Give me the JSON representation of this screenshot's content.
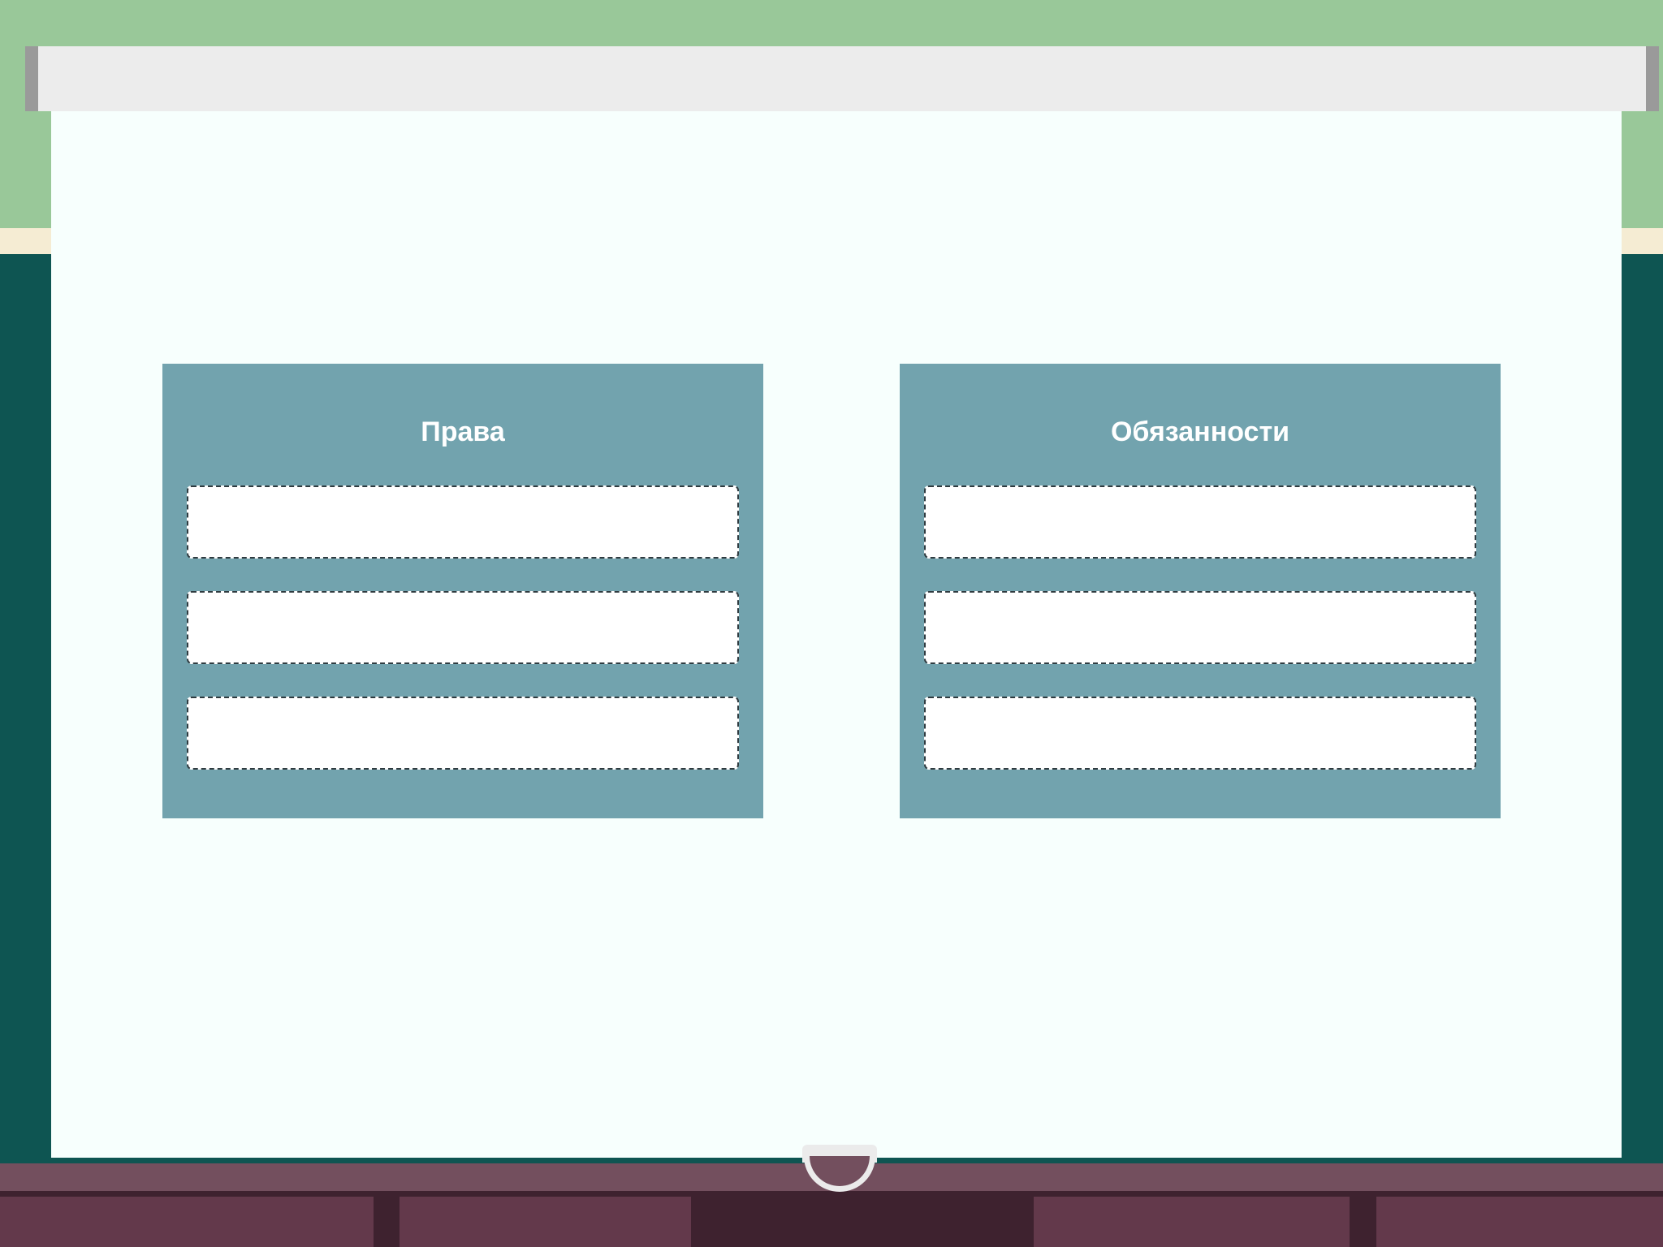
{
  "colors": {
    "wall_top": "#99c899",
    "wall_trim": "#f5ecd3",
    "wall_lower": "#0e5552",
    "screen_background": "#f7fffd",
    "panel_background": "#72a3ae",
    "slot_background": "#ffffff",
    "slot_border": "#2f3b40",
    "cabinet": "#63394b",
    "cabinet_rail": "#734f5e"
  },
  "board": {
    "categories": [
      {
        "title": "Права",
        "slots": [
          "",
          "",
          ""
        ]
      },
      {
        "title": "Обязанности",
        "slots": [
          "",
          "",
          ""
        ]
      }
    ]
  }
}
